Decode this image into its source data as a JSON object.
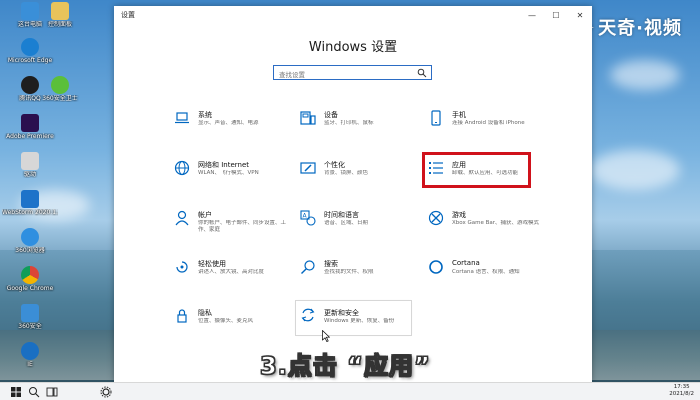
{
  "window": {
    "title": "设置",
    "page_title": "Windows 设置",
    "controls": {
      "minimize": "—",
      "maximize": "☐",
      "close": "✕"
    }
  },
  "search": {
    "placeholder": "查找设置"
  },
  "tiles": [
    {
      "name": "系统",
      "desc": "显示、声音、通知、电源",
      "icon": "laptop-icon"
    },
    {
      "name": "设备",
      "desc": "蓝牙、打印机、鼠标",
      "icon": "devices-icon"
    },
    {
      "name": "手机",
      "desc": "连接 Android 设备和 iPhone",
      "icon": "phone-icon"
    },
    {
      "name": "网络和 Internet",
      "desc": "WLAN、飞行模式、VPN",
      "icon": "globe-icon"
    },
    {
      "name": "个性化",
      "desc": "背景、锁屏、颜色",
      "icon": "personalize-icon"
    },
    {
      "name": "应用",
      "desc": "卸载、默认应用、可选功能",
      "icon": "apps-icon"
    },
    {
      "name": "帐户",
      "desc": "你的帐户、电子邮件、同步设置、工作、家庭",
      "icon": "account-icon"
    },
    {
      "name": "时间和语言",
      "desc": "语音、区域、日期",
      "icon": "time-language-icon"
    },
    {
      "name": "游戏",
      "desc": "Xbox Game Bar、捕获、游戏模式",
      "icon": "xbox-icon"
    },
    {
      "name": "轻松使用",
      "desc": "讲述人、放大镜、高对比度",
      "icon": "ease-of-access-icon"
    },
    {
      "name": "搜索",
      "desc": "查找我的文件、权限",
      "icon": "search-icon"
    },
    {
      "name": "Cortana",
      "desc": "Cortana 语言、权限、通知",
      "icon": "cortana-icon"
    },
    {
      "name": "隐私",
      "desc": "位置、摄像头、麦克风",
      "icon": "lock-icon"
    },
    {
      "name": "更新和安全",
      "desc": "Windows 更新、恢复、备份",
      "icon": "update-icon"
    }
  ],
  "caption": "3.点击 “应用”",
  "watermark": "天奇·视频",
  "desktop_icons": [
    {
      "label": "这台电脑",
      "color": "#3a8fd8"
    },
    {
      "label": "Microsoft Edge",
      "color": "#1b7fd1"
    },
    {
      "label": "控制面板",
      "color": "#5a9ad6"
    },
    {
      "label": "腾讯QQ",
      "color": "#1e1e1e"
    },
    {
      "label": "360安全卫士",
      "color": "#5bbf3a"
    },
    {
      "label": "Adobe Premiere",
      "color": "#2a0f4f"
    },
    {
      "label": "驱动",
      "color": "#d7d7d7"
    },
    {
      "label": "WebStorm 2020.1.2",
      "color": "#1e73c9"
    },
    {
      "label": "360浏览器",
      "color": "#2f8fe0"
    },
    {
      "label": "Google Chrome",
      "color": "#db4437"
    },
    {
      "label": "360安全",
      "color": "#3b8ed6"
    },
    {
      "label": "IE",
      "color": "#1a6fc2"
    }
  ],
  "taskbar": {
    "time": "17:35",
    "date": "2021/8/2"
  },
  "colors": {
    "accent": "#0067c0",
    "highlight": "#d0121b"
  }
}
